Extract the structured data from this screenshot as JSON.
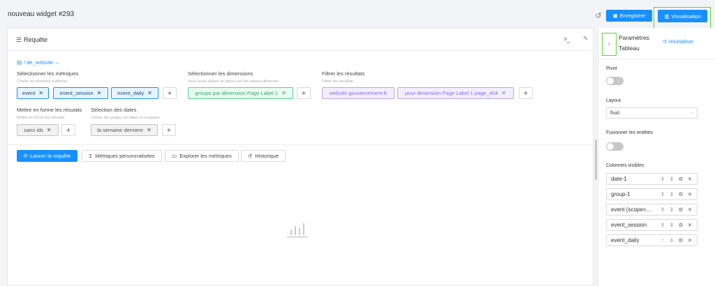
{
  "header": {
    "widget_title": "nouveau widget #293",
    "save_label": "Enregistrer",
    "visualisation_label": "Visualisation"
  },
  "query_panel": {
    "title": "Requête",
    "datasource": "/ de_website",
    "metrics": {
      "label": "Sélectionner les métriques",
      "hint": "Choisir les données à afficher",
      "tags": [
        "event",
        "event_session",
        "event_daily"
      ]
    },
    "dimensions": {
      "label": "Sélectionner les dimensions",
      "hint": "Vous aurez autant de lignes que de valeurs distinctes",
      "tags": [
        "groupe par dimension Page Label 1"
      ]
    },
    "filters": {
      "label": "Filtrer les résultats",
      "hint": "Filtrer les résultats",
      "tags": [
        "website gouvernement-fr",
        "pour dimension Page Label 1 page_404"
      ]
    },
    "format": {
      "label": "Mettre en forme les résutats",
      "hint": "Mettre en forme les résutats",
      "tags": [
        "sans ids"
      ]
    },
    "dates": {
      "label": "Sélection des dates",
      "hint": "Choisir des plages de dates et comparer",
      "tags": [
        "la semaine derniere"
      ]
    },
    "actions": {
      "run": "Lancer la requête",
      "custom_metrics": "Métriques personnalisées",
      "explore": "Explorer les métriques",
      "history": "Historique"
    }
  },
  "settings_panel": {
    "title": "Paramètres Tableau",
    "reset": "réinitialiser",
    "pivot_label": "Pivot",
    "pivot_on": false,
    "layout_label": "Layout",
    "layout_value": "fluid",
    "merge_headers_label": "Fusionner les entêtes",
    "merge_headers_on": false,
    "visible_columns_label": "Colonnes visibles",
    "columns": [
      "date-1",
      "group-1",
      "event (scope=event)",
      "event_session",
      "event_daily"
    ]
  },
  "colors": {
    "primary": "#1890ff",
    "highlight": "#5fd13a"
  }
}
